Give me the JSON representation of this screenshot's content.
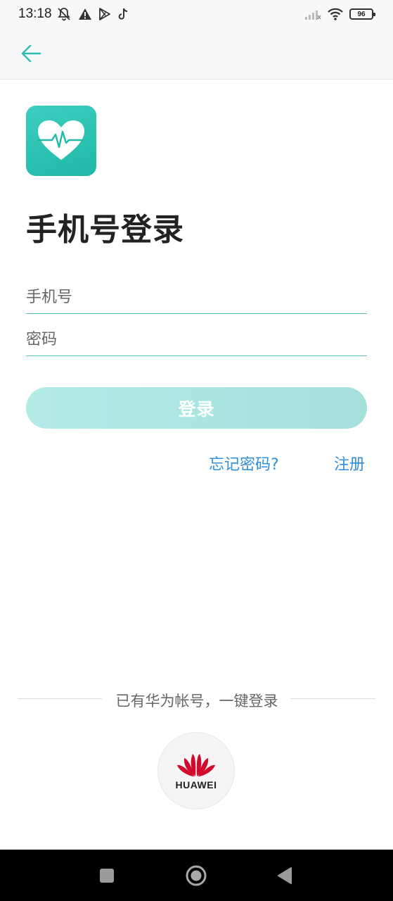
{
  "status_bar": {
    "time": "13:18",
    "left_icons": [
      "notifications-off-icon",
      "warning-icon",
      "play-store-icon",
      "tiktok-icon"
    ],
    "right_icons": [
      "signal-icon",
      "wifi-icon",
      "battery-icon"
    ],
    "battery_level": "96"
  },
  "header": {
    "back_icon": "arrow-left-icon"
  },
  "app": {
    "logo_icon": "heart-pulse-icon"
  },
  "login": {
    "title": "手机号登录",
    "phone_placeholder": "手机号",
    "password_placeholder": "密码",
    "submit_label": "登录",
    "forgot_password": "忘记密码?",
    "register": "注册"
  },
  "third_party": {
    "divider_text": "已有华为帐号，一键登录",
    "huawei_label": "HUAWEI"
  },
  "nav_bar": {
    "icons": [
      "square-recent-icon",
      "circle-home-icon",
      "triangle-back-icon"
    ]
  },
  "colors": {
    "accent": "#2ebfb0",
    "link": "#2e8fdc",
    "button_bg": "#aee6e1",
    "huawei_red": "#cf0a2c"
  }
}
